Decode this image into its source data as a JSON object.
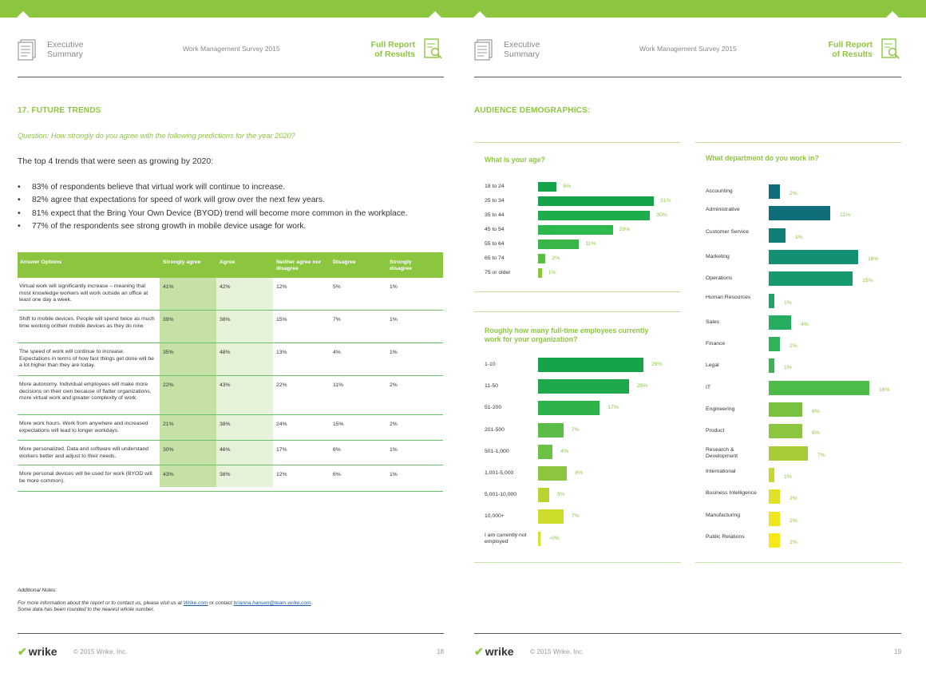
{
  "header": {
    "exec_line1": "Executive",
    "exec_line2": "Summary",
    "survey": "Work Management Survey 2015",
    "full_line1": "Full Report",
    "full_line2": "of Results"
  },
  "left": {
    "section_title": "17. FUTURE TRENDS",
    "question": "Question: How strongly do you agree with the following predictions for the year 2020?",
    "intro": "The top 4 trends that were seen as growing by 2020:",
    "bullets": [
      "83% of respondents believe that virtual work will continue to increase.",
      "82% agree that expectations for speed of work will grow over the next few years.",
      "81% expect that the Bring Your Own Device (BYOD) trend will become more common in the workplace.",
      "77% of the respondents see strong growth in mobile device usage for work."
    ],
    "table": {
      "headers": [
        "Answer Options",
        "Strongly agree",
        "Agree",
        "Neither agree nor disagree",
        "Disagree",
        "Strongly disagree"
      ],
      "rows": [
        {
          "desc": "Virtual work will significantly increase – meaning that most knowledge workers will work outside an office at least one day a week.",
          "vals": [
            "41%",
            "42%",
            "12%",
            "5%",
            "1%"
          ]
        },
        {
          "desc": "Shift to mobile devices. People will spend twice as much time working ontheir mobile devices as they do now.",
          "vals": [
            "39%",
            "38%",
            "15%",
            "7%",
            "1%"
          ]
        },
        {
          "desc": "The speed of work will continue to increase. Expectations in terms of how fast things get done will be a lot higher than they are today.",
          "vals": [
            "35%",
            "48%",
            "13%",
            "4%",
            "1%"
          ]
        },
        {
          "desc": "More autonomy. Individual employees will make more decisions on their own because of flatter organizations, more virtual work and greater complexity of work.",
          "vals": [
            "22%",
            "43%",
            "22%",
            "11%",
            "2%"
          ]
        },
        {
          "desc": "More work hours. Work from anywhere and increased expectations will lead to longer workdays.",
          "vals": [
            "21%",
            "38%",
            "24%",
            "15%",
            "2%"
          ]
        },
        {
          "desc": "More personalized. Data and software will understand workers better and adjust to their needs.",
          "vals": [
            "30%",
            "46%",
            "17%",
            "6%",
            "1%"
          ]
        },
        {
          "desc": "More personal devices will be used for work (BYOD will be more common).",
          "vals": [
            "43%",
            "38%",
            "12%",
            "6%",
            "1%"
          ]
        }
      ]
    },
    "notes_heading": "Additional Notes:",
    "notes_line1_pre": "For more information about the report or to contact us, please visit us at ",
    "notes_link1": "Wrike.com",
    "notes_line1_mid": " or contact ",
    "notes_link2": "brianna.hansen@team.wrike.com",
    "notes_line1_post": ".",
    "notes_line2": "Some data has been rounded to the nearest whole number.",
    "page_number": "18"
  },
  "right": {
    "section_title": "AUDIENCE DEMOGRAPHICS:",
    "page_number": "19"
  },
  "footer": {
    "logo": "wrike",
    "copyright": "© 2015 Wrike, Inc."
  },
  "chart_data": [
    {
      "type": "bar",
      "title": "What is your age?",
      "categories": [
        "18 to 24",
        "25 to 34",
        "35 to 44",
        "45 to 54",
        "55 to 64",
        "65 to 74",
        "75 or older"
      ],
      "values": [
        5,
        31,
        30,
        20,
        11,
        2,
        1
      ],
      "value_labels": [
        "5%",
        "31%",
        "30%",
        "20%",
        "11%",
        "2%",
        "1%"
      ],
      "colors": [
        "#16a34a",
        "#16a34a",
        "#1fad4c",
        "#2db84b",
        "#3ab54a",
        "#5bbd46",
        "#8cc63f"
      ]
    },
    {
      "type": "bar",
      "title": "Roughly how many full-time employees currently work for your organization?",
      "categories": [
        "1-10",
        "11-50",
        "51-200",
        "201-500",
        "501-1,000",
        "1,001-5,000",
        "5,001-10,000",
        "10,000+",
        "I am currently not employed"
      ],
      "values": [
        29,
        25,
        17,
        7,
        4,
        8,
        3,
        7,
        0
      ],
      "value_labels": [
        "29%",
        "25%",
        "17%",
        "7%",
        "4%",
        "8%",
        "3%",
        "7%",
        "~0%"
      ],
      "colors": [
        "#16a34a",
        "#1ea84b",
        "#2eb24a",
        "#5bbd46",
        "#6cc043",
        "#8cc63f",
        "#b8d433",
        "#cddc2a",
        "#d8e028"
      ]
    },
    {
      "type": "bar",
      "title": "What department do you work in?",
      "categories": [
        "Accounting",
        "Administrative",
        "Customer Service",
        "Marketing",
        "Operations",
        "Human Resources",
        "Sales",
        "Finance",
        "Legal",
        "IT",
        "Engineering",
        "Product",
        "Research & Development",
        "International",
        "Business Intelligence",
        "Manufacturing",
        "Public Relations"
      ],
      "values": [
        2,
        11,
        3,
        16,
        15,
        1,
        4,
        2,
        1,
        18,
        6,
        6,
        7,
        1,
        2,
        2,
        2
      ],
      "value_labels": [
        "2%",
        "11%",
        "3%",
        "16%",
        "15%",
        "1%",
        "4%",
        "2%",
        "1%",
        "18%",
        "6%",
        "6%",
        "7%",
        "1%",
        "2%",
        "2%",
        "2%"
      ],
      "colors": [
        "#0f6e7a",
        "#0f6e7a",
        "#127f77",
        "#139073",
        "#17996e",
        "#1ea66a",
        "#27ad60",
        "#2fb25a",
        "#38b552",
        "#4cbb48",
        "#78c23f",
        "#8cc63f",
        "#a6cd38",
        "#c4d82e",
        "#e0e22a",
        "#f0e61e",
        "#f7e81a"
      ]
    }
  ]
}
